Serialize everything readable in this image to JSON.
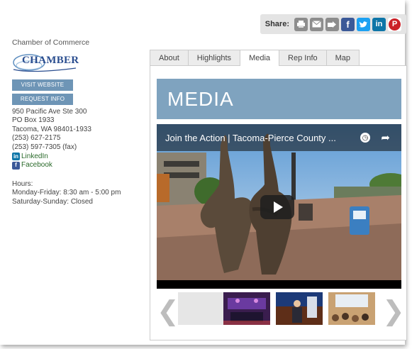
{
  "share": {
    "label": "Share:",
    "icons": [
      "print-icon",
      "email-icon",
      "bookmark-icon",
      "facebook-icon",
      "twitter-icon",
      "linkedin-icon",
      "pinterest-icon"
    ],
    "glyphs": {
      "facebook": "f",
      "twitter": "t",
      "linkedin": "in",
      "pinterest": "P"
    }
  },
  "sidebar": {
    "org_name": "Chamber of Commerce",
    "logo_text": "CHAMBER",
    "visit_button": "VISIT WEBSITE",
    "request_button": "REQUEST INFO",
    "address": [
      "950 Pacific Ave Ste 300",
      " PO Box 1933",
      "Tacoma, WA 98401-1933",
      "(253) 627-2175",
      "(253) 597-7305 (fax)"
    ],
    "linkedin_label": "LinkedIn",
    "facebook_label": "Facebook",
    "hours_title": "Hours:",
    "hours": [
      "Monday-Friday: 8:30 am - 5:00 pm",
      "Saturday-Sunday: Closed"
    ]
  },
  "tabs": [
    {
      "label": "About",
      "active": false
    },
    {
      "label": "Highlights",
      "active": false
    },
    {
      "label": "Media",
      "active": true
    },
    {
      "label": "Rep Info",
      "active": false
    },
    {
      "label": "Map",
      "active": false
    }
  ],
  "media": {
    "title": "MEDIA",
    "video_title": "Join the Action | Tacoma-Pierce County ..."
  },
  "colors": {
    "banner": "#7fa3bf",
    "button": "#6e95b6",
    "facebook": "#3b5998",
    "twitter": "#1da1f2",
    "linkedin": "#0e76a8",
    "pinterest": "#cb2027"
  }
}
